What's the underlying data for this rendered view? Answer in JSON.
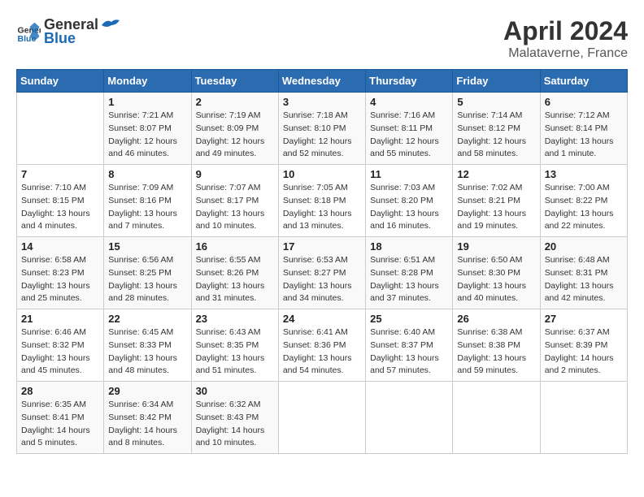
{
  "header": {
    "logo_general": "General",
    "logo_blue": "Blue",
    "month": "April 2024",
    "location": "Malataverne, France"
  },
  "calendar": {
    "days_of_week": [
      "Sunday",
      "Monday",
      "Tuesday",
      "Wednesday",
      "Thursday",
      "Friday",
      "Saturday"
    ],
    "weeks": [
      [
        {
          "day": "",
          "info": ""
        },
        {
          "day": "1",
          "info": "Sunrise: 7:21 AM\nSunset: 8:07 PM\nDaylight: 12 hours\nand 46 minutes."
        },
        {
          "day": "2",
          "info": "Sunrise: 7:19 AM\nSunset: 8:09 PM\nDaylight: 12 hours\nand 49 minutes."
        },
        {
          "day": "3",
          "info": "Sunrise: 7:18 AM\nSunset: 8:10 PM\nDaylight: 12 hours\nand 52 minutes."
        },
        {
          "day": "4",
          "info": "Sunrise: 7:16 AM\nSunset: 8:11 PM\nDaylight: 12 hours\nand 55 minutes."
        },
        {
          "day": "5",
          "info": "Sunrise: 7:14 AM\nSunset: 8:12 PM\nDaylight: 12 hours\nand 58 minutes."
        },
        {
          "day": "6",
          "info": "Sunrise: 7:12 AM\nSunset: 8:14 PM\nDaylight: 13 hours\nand 1 minute."
        }
      ],
      [
        {
          "day": "7",
          "info": "Sunrise: 7:10 AM\nSunset: 8:15 PM\nDaylight: 13 hours\nand 4 minutes."
        },
        {
          "day": "8",
          "info": "Sunrise: 7:09 AM\nSunset: 8:16 PM\nDaylight: 13 hours\nand 7 minutes."
        },
        {
          "day": "9",
          "info": "Sunrise: 7:07 AM\nSunset: 8:17 PM\nDaylight: 13 hours\nand 10 minutes."
        },
        {
          "day": "10",
          "info": "Sunrise: 7:05 AM\nSunset: 8:18 PM\nDaylight: 13 hours\nand 13 minutes."
        },
        {
          "day": "11",
          "info": "Sunrise: 7:03 AM\nSunset: 8:20 PM\nDaylight: 13 hours\nand 16 minutes."
        },
        {
          "day": "12",
          "info": "Sunrise: 7:02 AM\nSunset: 8:21 PM\nDaylight: 13 hours\nand 19 minutes."
        },
        {
          "day": "13",
          "info": "Sunrise: 7:00 AM\nSunset: 8:22 PM\nDaylight: 13 hours\nand 22 minutes."
        }
      ],
      [
        {
          "day": "14",
          "info": "Sunrise: 6:58 AM\nSunset: 8:23 PM\nDaylight: 13 hours\nand 25 minutes."
        },
        {
          "day": "15",
          "info": "Sunrise: 6:56 AM\nSunset: 8:25 PM\nDaylight: 13 hours\nand 28 minutes."
        },
        {
          "day": "16",
          "info": "Sunrise: 6:55 AM\nSunset: 8:26 PM\nDaylight: 13 hours\nand 31 minutes."
        },
        {
          "day": "17",
          "info": "Sunrise: 6:53 AM\nSunset: 8:27 PM\nDaylight: 13 hours\nand 34 minutes."
        },
        {
          "day": "18",
          "info": "Sunrise: 6:51 AM\nSunset: 8:28 PM\nDaylight: 13 hours\nand 37 minutes."
        },
        {
          "day": "19",
          "info": "Sunrise: 6:50 AM\nSunset: 8:30 PM\nDaylight: 13 hours\nand 40 minutes."
        },
        {
          "day": "20",
          "info": "Sunrise: 6:48 AM\nSunset: 8:31 PM\nDaylight: 13 hours\nand 42 minutes."
        }
      ],
      [
        {
          "day": "21",
          "info": "Sunrise: 6:46 AM\nSunset: 8:32 PM\nDaylight: 13 hours\nand 45 minutes."
        },
        {
          "day": "22",
          "info": "Sunrise: 6:45 AM\nSunset: 8:33 PM\nDaylight: 13 hours\nand 48 minutes."
        },
        {
          "day": "23",
          "info": "Sunrise: 6:43 AM\nSunset: 8:35 PM\nDaylight: 13 hours\nand 51 minutes."
        },
        {
          "day": "24",
          "info": "Sunrise: 6:41 AM\nSunset: 8:36 PM\nDaylight: 13 hours\nand 54 minutes."
        },
        {
          "day": "25",
          "info": "Sunrise: 6:40 AM\nSunset: 8:37 PM\nDaylight: 13 hours\nand 57 minutes."
        },
        {
          "day": "26",
          "info": "Sunrise: 6:38 AM\nSunset: 8:38 PM\nDaylight: 13 hours\nand 59 minutes."
        },
        {
          "day": "27",
          "info": "Sunrise: 6:37 AM\nSunset: 8:39 PM\nDaylight: 14 hours\nand 2 minutes."
        }
      ],
      [
        {
          "day": "28",
          "info": "Sunrise: 6:35 AM\nSunset: 8:41 PM\nDaylight: 14 hours\nand 5 minutes."
        },
        {
          "day": "29",
          "info": "Sunrise: 6:34 AM\nSunset: 8:42 PM\nDaylight: 14 hours\nand 8 minutes."
        },
        {
          "day": "30",
          "info": "Sunrise: 6:32 AM\nSunset: 8:43 PM\nDaylight: 14 hours\nand 10 minutes."
        },
        {
          "day": "",
          "info": ""
        },
        {
          "day": "",
          "info": ""
        },
        {
          "day": "",
          "info": ""
        },
        {
          "day": "",
          "info": ""
        }
      ]
    ]
  }
}
